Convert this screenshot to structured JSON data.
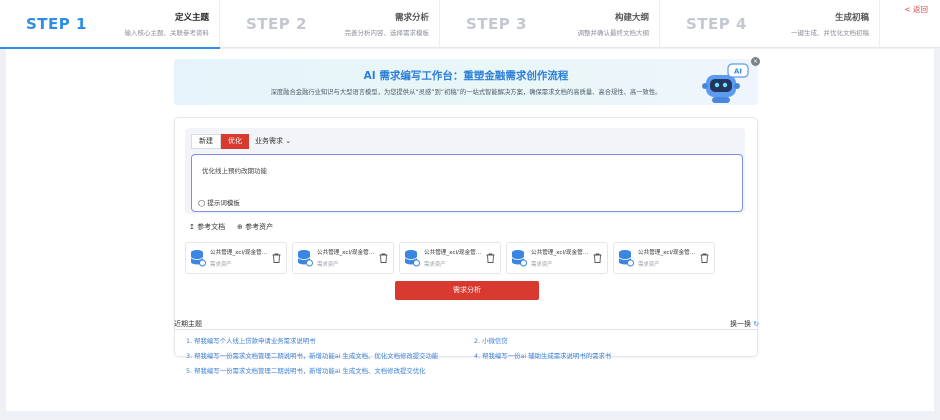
{
  "steps": [
    {
      "num": "STEP 1",
      "title": "定义主题",
      "sub": "输入核心主题、关联参考资料",
      "active": true
    },
    {
      "num": "STEP 2",
      "title": "需求分析",
      "sub": "完善分析内容、选择需求模板",
      "active": false
    },
    {
      "num": "STEP 3",
      "title": "构建大纲",
      "sub": "调整并确认最终文档大纲",
      "active": false
    },
    {
      "num": "STEP 4",
      "title": "生成初稿",
      "sub": "一键生成、并优化文档初稿",
      "active": false
    }
  ],
  "back": "< 返回",
  "banner": {
    "title": "AI 需求编写工作台：重塑金融需求创作流程",
    "subtitle": "深度融合金融行业知识与大型语言模型，为您提供从“灵感”到“初稿”的一站式智能解决方案，确保需求文档的高质量、高合规性、高一致性。",
    "close": "×",
    "robot_badge": "AI"
  },
  "editor": {
    "mode_new": "新建",
    "mode_optimize": "优化",
    "biz_select": "业务需求",
    "input_value": "优化线上预约改期功能",
    "template_btn": "提示词模板"
  },
  "refs": {
    "doc": "参考文档",
    "asset": "参考资产"
  },
  "assets": [
    {
      "name": "公共管理_xcl/现金管…",
      "type": "需求资产"
    },
    {
      "name": "公共管理_xcl/现金管…",
      "type": "需求资产"
    },
    {
      "name": "公共管理_xcl/现金管…",
      "type": "需求资产"
    },
    {
      "name": "公共管理_xcl/现金管…",
      "type": "需求资产"
    },
    {
      "name": "公共管理_xcl/现金管…",
      "type": "需求资产"
    }
  ],
  "analyze_btn": "需求分析",
  "recent": {
    "title": "近期主题",
    "refresh": "换一换",
    "topics": [
      "1. 帮我编写个人线上贷款申请业务需求说明书",
      "2. 小微信贷",
      "3. 帮我编写一份需求文档管理二期说明书，新增功能ai 生成文档、优化文档修改提交功能",
      "4. 帮我编写一份ai 辅助生成需求说明书的需求书",
      "5. 帮我编写一份需求文档管理二期说明书，新增功能ai 生成文档、文档修改提交优化"
    ]
  },
  "colors": {
    "accent_blue": "#2d8de8",
    "brand_red": "#d93a2f",
    "link_blue": "#3b7fd6"
  }
}
